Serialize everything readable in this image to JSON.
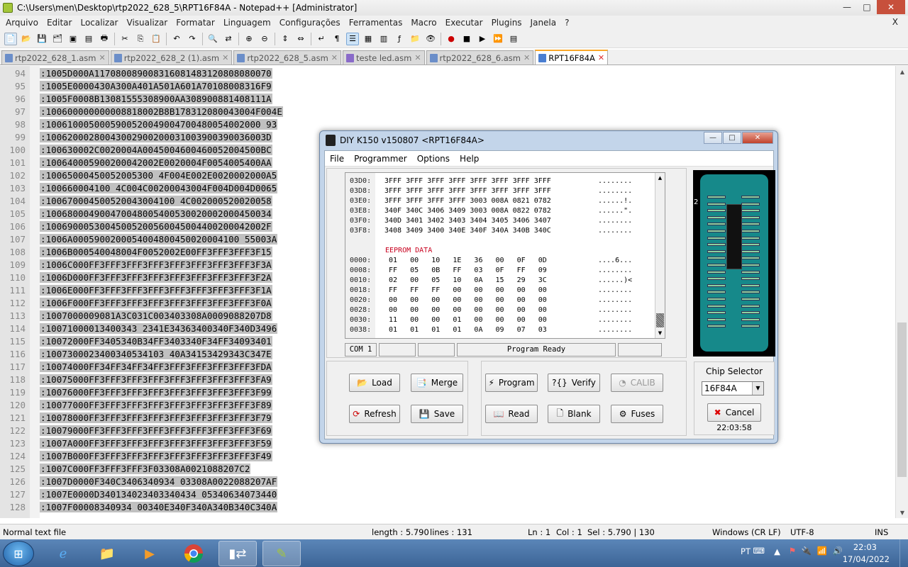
{
  "window": {
    "title": "C:\\Users\\men\\Desktop\\rtp2022_628_5\\RPT16F84A - Notepad++ [Administrator]",
    "controls": {
      "minimize": "—",
      "maximize": "□",
      "close": "✕"
    }
  },
  "menu": [
    "Arquivo",
    "Editar",
    "Localizar",
    "Visualizar",
    "Formatar",
    "Linguagem",
    "Configurações",
    "Ferramentas",
    "Macro",
    "Executar",
    "Plugins",
    "Janela",
    "?"
  ],
  "menu_close": "X",
  "tabs": [
    {
      "label": "rtp2022_628_1.asm",
      "close": "✕",
      "active": false
    },
    {
      "label": "rtp2022_628_2 (1).asm",
      "close": "✕",
      "active": false
    },
    {
      "label": "rtp2022_628_5.asm",
      "close": "✕",
      "active": false
    },
    {
      "label": "teste led.asm",
      "close": "✕",
      "active": false
    },
    {
      "label": "rtp2022_628_6.asm",
      "close": "✕",
      "active": false
    },
    {
      "label": "RPT16F84A",
      "close": "✕",
      "active": true
    }
  ],
  "editor": {
    "lines": [
      {
        "n": "94",
        "t": ":1005D000A117080089008316081483120808080070"
      },
      {
        "n": "95",
        "t": ":1005E0000430A300A401A501A601A70108008316F9"
      },
      {
        "n": "96",
        "t": ":1005F0008B13081555308900AA308900881408111A"
      },
      {
        "n": "97",
        "t": ":100600000000008818002B8B178312080043004F004E"
      },
      {
        "n": "98",
        "t": ":1006100050005900520049004700480054002000 93"
      },
      {
        "n": "99",
        "t": ":10062000280043002900200031003900390036003D"
      },
      {
        "n": "100",
        "t": ":100630002C0020004A0045004600460052004500BC"
      },
      {
        "n": "101",
        "t": ":100640005900200042002E0020004F0054005400AA"
      },
      {
        "n": "102",
        "t": ":10065000450052005300 4F004E002E0020002000A5"
      },
      {
        "n": "103",
        "t": ":100660004100 4C004C00200043004F004D004D0065"
      },
      {
        "n": "104",
        "t": ":100670004500520043004100 4C002000520020058"
      },
      {
        "n": "105",
        "t": ":100680004900470048005400530020002000450034"
      },
      {
        "n": "106",
        "t": ":10069000530045005200560045004400200042002F"
      },
      {
        "n": "107",
        "t": ":1006A0005900200054004800450020004100 55003A"
      },
      {
        "n": "108",
        "t": ":1006B000540048004F0052002E00FF3FFF3FFF3F15"
      },
      {
        "n": "109",
        "t": ":1006C000FF3FFF3FFF3FFF3FFF3FFF3FFF3FFF3F3A"
      },
      {
        "n": "110",
        "t": ":1006D000FF3FFF3FFF3FFF3FFF3FFF3FFF3FFF3F2A"
      },
      {
        "n": "111",
        "t": ":1006E000FF3FFF3FFF3FFF3FFF3FFF3FFF3FFF3F1A"
      },
      {
        "n": "112",
        "t": ":1006F000FF3FFF3FFF3FFF3FFF3FFF3FFF3FFF3F0A"
      },
      {
        "n": "113",
        "t": ":1007000009081A3C031C003403308A0009088207D8"
      },
      {
        "n": "114",
        "t": ":10071000013400343 2341E34363400340F340D3496"
      },
      {
        "n": "115",
        "t": ":10072000FF3405340B34FF3403340F34FF34093401"
      },
      {
        "n": "116",
        "t": ":1007300023400340534103 40A34153429343C347E"
      },
      {
        "n": "117",
        "t": ":10074000FF34FF34FF34FF3FFF3FFF3FFF3FFF3FDA"
      },
      {
        "n": "118",
        "t": ":10075000FF3FFF3FFF3FFF3FFF3FFF3FFF3FFF3FA9"
      },
      {
        "n": "119",
        "t": ":10076000FF3FFF3FFF3FFF3FFF3FFF3FFF3FFF3F99"
      },
      {
        "n": "120",
        "t": ":10077000FF3FFF3FFF3FFF3FFF3FFF3FFF3FFF3F89"
      },
      {
        "n": "121",
        "t": ":10078000FF3FFF3FFF3FFF3FFF3FFF3FFF3FFF3F79"
      },
      {
        "n": "122",
        "t": ":10079000FF3FFF3FFF3FFF3FFF3FFF3FFF3FFF3F69"
      },
      {
        "n": "123",
        "t": ":1007A000FF3FFF3FFF3FFF3FFF3FFF3FFF3FFF3F59"
      },
      {
        "n": "124",
        "t": ":1007B000FF3FFF3FFF3FFF3FFF3FFF3FFF3FFF3F49"
      },
      {
        "n": "125",
        "t": ":1007C000FF3FFF3FFF3F03308A0021088207C2"
      },
      {
        "n": "126",
        "t": ":1007D0000F340C3406340934 03308A0022088207AF"
      },
      {
        "n": "127",
        "t": ":1007E0000D340134023403340434 05340634073440"
      },
      {
        "n": "128",
        "t": ":1007F00008340934 00340E340F340A340B340C340A"
      }
    ]
  },
  "statusbar": {
    "type": "Normal text file",
    "length": "length : 5.790",
    "lines": "lines : 131",
    "ln": "Ln : 1",
    "col": "Col : 1",
    "sel": "Sel : 5.790 | 130",
    "eol": "Windows (CR LF)",
    "encoding": "UTF-8",
    "mode": "INS"
  },
  "taskbar": {
    "lang": "PT",
    "time": "22:03",
    "date": "17/04/2022"
  },
  "diy": {
    "title": "DIY K150 v150807  <RPT16F84A>",
    "menu": [
      "File",
      "Programmer",
      "Options",
      "Help"
    ],
    "hex_rows": [
      {
        "a": "03D0:",
        "d": "3FFF 3FFF 3FFF 3FFF 3FFF 3FFF 3FFF 3FFF",
        "s": "........"
      },
      {
        "a": "03D8:",
        "d": "3FFF 3FFF 3FFF 3FFF 3FFF 3FFF 3FFF 3FFF",
        "s": "........"
      },
      {
        "a": "03E0:",
        "d": "3FFF 3FFF 3FFF 3FFF 3003 008A 0821 0782",
        "s": "......!."
      },
      {
        "a": "03E8:",
        "d": "340F 340C 3406 3409 3003 008A 0822 0782",
        "s": "......\"."
      },
      {
        "a": "03F0:",
        "d": "340D 3401 3402 3403 3404 3405 3406 3407",
        "s": "........"
      },
      {
        "a": "03F8:",
        "d": "3408 3409 3400 340E 340F 340A 340B 340C",
        "s": "........"
      }
    ],
    "eeprom_label": "EEPROM DATA",
    "eeprom_rows": [
      {
        "a": "0000:",
        "d": " 01   00   10   1E   36   00   0F   0D",
        "s": "....6..."
      },
      {
        "a": "0008:",
        "d": " FF   05   0B   FF   03   0F   FF   09",
        "s": "........"
      },
      {
        "a": "0010:",
        "d": " 02   00   05   10   0A   15   29   3C",
        "s": "......)<"
      },
      {
        "a": "0018:",
        "d": " FF   FF   FF   00   00   00   00   00",
        "s": "........"
      },
      {
        "a": "0020:",
        "d": " 00   00   00   00   00   00   00   00",
        "s": "........"
      },
      {
        "a": "0028:",
        "d": " 00   00   00   00   00   00   00   00",
        "s": "........"
      },
      {
        "a": "0030:",
        "d": " 11   00   00   01   00   00   00   00",
        "s": "........"
      },
      {
        "a": "0038:",
        "d": " 01   01   01   01   0A   09   07   03",
        "s": "........"
      }
    ],
    "com_port": "COM 1",
    "status": "Program Ready",
    "buttons": {
      "load": "Load",
      "merge": "Merge",
      "refresh": "Refresh",
      "save": "Save",
      "program": "Program",
      "verify": "Verify",
      "calib": "CALIB",
      "read": "Read",
      "blank": "Blank",
      "fuses": "Fuses",
      "cancel": "Cancel"
    },
    "chip_selector_label": "Chip Selector",
    "chip": "16F84A",
    "clock": "22:03:58",
    "pin_marker": "2"
  },
  "colors": {
    "accent": "#f9a72a",
    "socket": "#16898a",
    "eeprom": "#c8001e",
    "selection": "#c0c0c0"
  }
}
